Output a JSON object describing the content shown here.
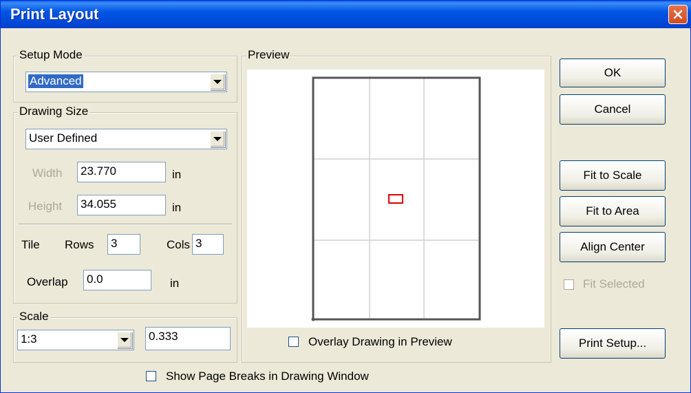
{
  "window": {
    "title": "Print Layout"
  },
  "setup_mode": {
    "label": "Setup Mode",
    "value": "Advanced"
  },
  "drawing_size": {
    "label": "Drawing Size",
    "value": "User Defined",
    "width_label": "Width",
    "width_value": "23.770",
    "height_label": "Height",
    "height_value": "34.055",
    "unit": "in"
  },
  "tile": {
    "label": "Tile",
    "rows_label": "Rows",
    "rows_value": "3",
    "cols_label": "Cols",
    "cols_value": "3",
    "overlap_label": "Overlap",
    "overlap_value": "0.0",
    "unit": "in"
  },
  "scale": {
    "label": "Scale",
    "ratio": "1:3",
    "factor": "0.333"
  },
  "preview": {
    "label": "Preview",
    "overlay_label": "Overlay Drawing in Preview",
    "overlay_checked": false,
    "tile_rows": 3,
    "tile_cols": 3
  },
  "buttons": {
    "ok": "OK",
    "cancel": "Cancel",
    "fit_scale": "Fit to Scale",
    "fit_area": "Fit to Area",
    "align_center": "Align Center",
    "print_setup": "Print Setup..."
  },
  "fit_selected": {
    "label": "Fit Selected",
    "checked": false,
    "enabled": false
  },
  "page_breaks": {
    "label": "Show Page Breaks in Drawing Window",
    "checked": false
  },
  "colors": {
    "title_bar": "#0054e3",
    "selection": "#316ac5",
    "drawing_marker": "#e00000",
    "grid": "#d0d0d0"
  },
  "icons": {
    "close": "close-icon",
    "dropdown": "chevron-down-icon"
  }
}
